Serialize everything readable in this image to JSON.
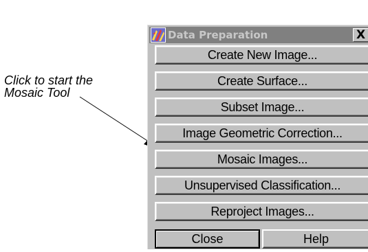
{
  "annotation": {
    "line1": "Click to start the",
    "line2": "Mosaic Tool"
  },
  "window": {
    "title": "Data Preparation",
    "close_glyph": "X",
    "icon": "app-logo-icon"
  },
  "menu": {
    "items": [
      {
        "label": "Create New Image..."
      },
      {
        "label": "Create Surface..."
      },
      {
        "label": "Subset Image..."
      },
      {
        "label": "Image Geometric Correction..."
      },
      {
        "label": "Mosaic Images..."
      },
      {
        "label": "Unsupervised Classification..."
      },
      {
        "label": "Reproject Images..."
      }
    ]
  },
  "footer": {
    "close_label": "Close",
    "help_label": "Help"
  },
  "colors": {
    "window_bg": "#c0c0c0",
    "titlebar_bg": "#808080",
    "title_text": "#c8c8c8"
  }
}
